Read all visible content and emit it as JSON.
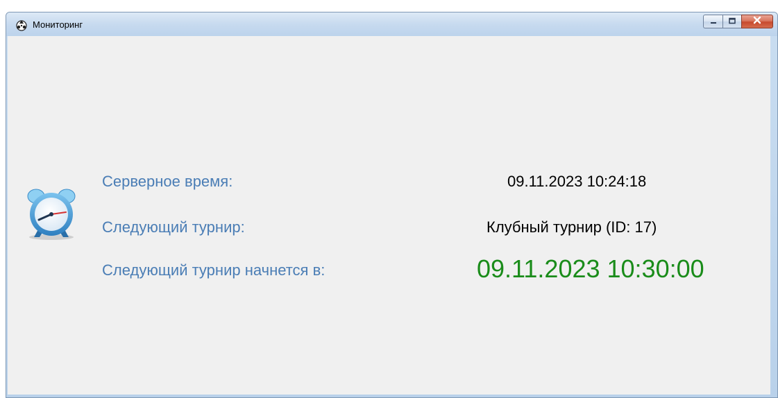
{
  "window": {
    "title": "Мониторинг",
    "icon": "app-logo-icon",
    "controls": {
      "minimize": "minimize-icon",
      "maximize": "maximize-icon",
      "close": "close-icon"
    }
  },
  "main": {
    "icon": "alarm-clock-icon",
    "server_time_label": "Серверное время:",
    "server_time_value": "09.11.2023 10:24:18",
    "next_tournament_label": "Следующий турнир:",
    "next_tournament_value": "Клубный турнир (ID: 17)",
    "next_start_label": "Следующий турнир начнется в:",
    "next_start_value": "09.11.2023 10:30:00"
  },
  "colors": {
    "label": "#4a7db5",
    "value": "#000000",
    "highlight": "#1a8c1a",
    "background": "#f0f0f0"
  }
}
